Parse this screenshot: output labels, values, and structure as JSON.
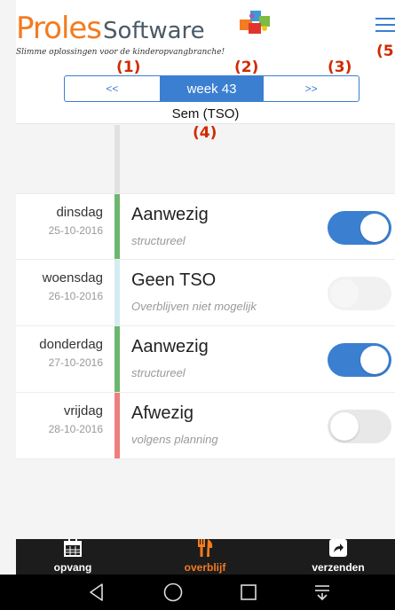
{
  "logo": {
    "brand_primary": "Proles",
    "brand_secondary": "Software",
    "tagline": "Slimme oplossingen voor de kinderopvangbranche!"
  },
  "annotations": [
    "(1)",
    "(2)",
    "(3)",
    "(4)",
    "(5"
  ],
  "week_nav": {
    "prev_label": "<<",
    "current_label": "week 43",
    "next_label": ">>"
  },
  "child_name": "Sem (TSO)",
  "days": [
    {
      "day": "dinsdag",
      "date": "25-10-2016",
      "status": "Aanwezig",
      "detail": "structureel",
      "bar_color": "#6db66d",
      "toggle": "on"
    },
    {
      "day": "woensdag",
      "date": "26-10-2016",
      "status": "Geen TSO",
      "detail": "Overblijven niet mogelijk",
      "bar_color": "#d3ecf2",
      "toggle": "disabled"
    },
    {
      "day": "donderdag",
      "date": "27-10-2016",
      "status": "Aanwezig",
      "detail": "structureel",
      "bar_color": "#6db66d",
      "toggle": "on"
    },
    {
      "day": "vrijdag",
      "date": "28-10-2016",
      "status": "Afwezig",
      "detail": "volgens planning",
      "bar_color": "#ee7f7f",
      "toggle": "off"
    }
  ],
  "tabs": [
    {
      "label": "opvang",
      "icon": "calendar-icon",
      "active": false
    },
    {
      "label": "overblijf",
      "icon": "cutlery-icon",
      "active": true
    },
    {
      "label": "verzenden",
      "icon": "share-icon",
      "active": false
    }
  ],
  "colors": {
    "accent": "#3b7fd1",
    "brand_orange": "#f47b20",
    "annotation_red": "#d12a00",
    "tabbar_bg": "#1c1c1c"
  }
}
